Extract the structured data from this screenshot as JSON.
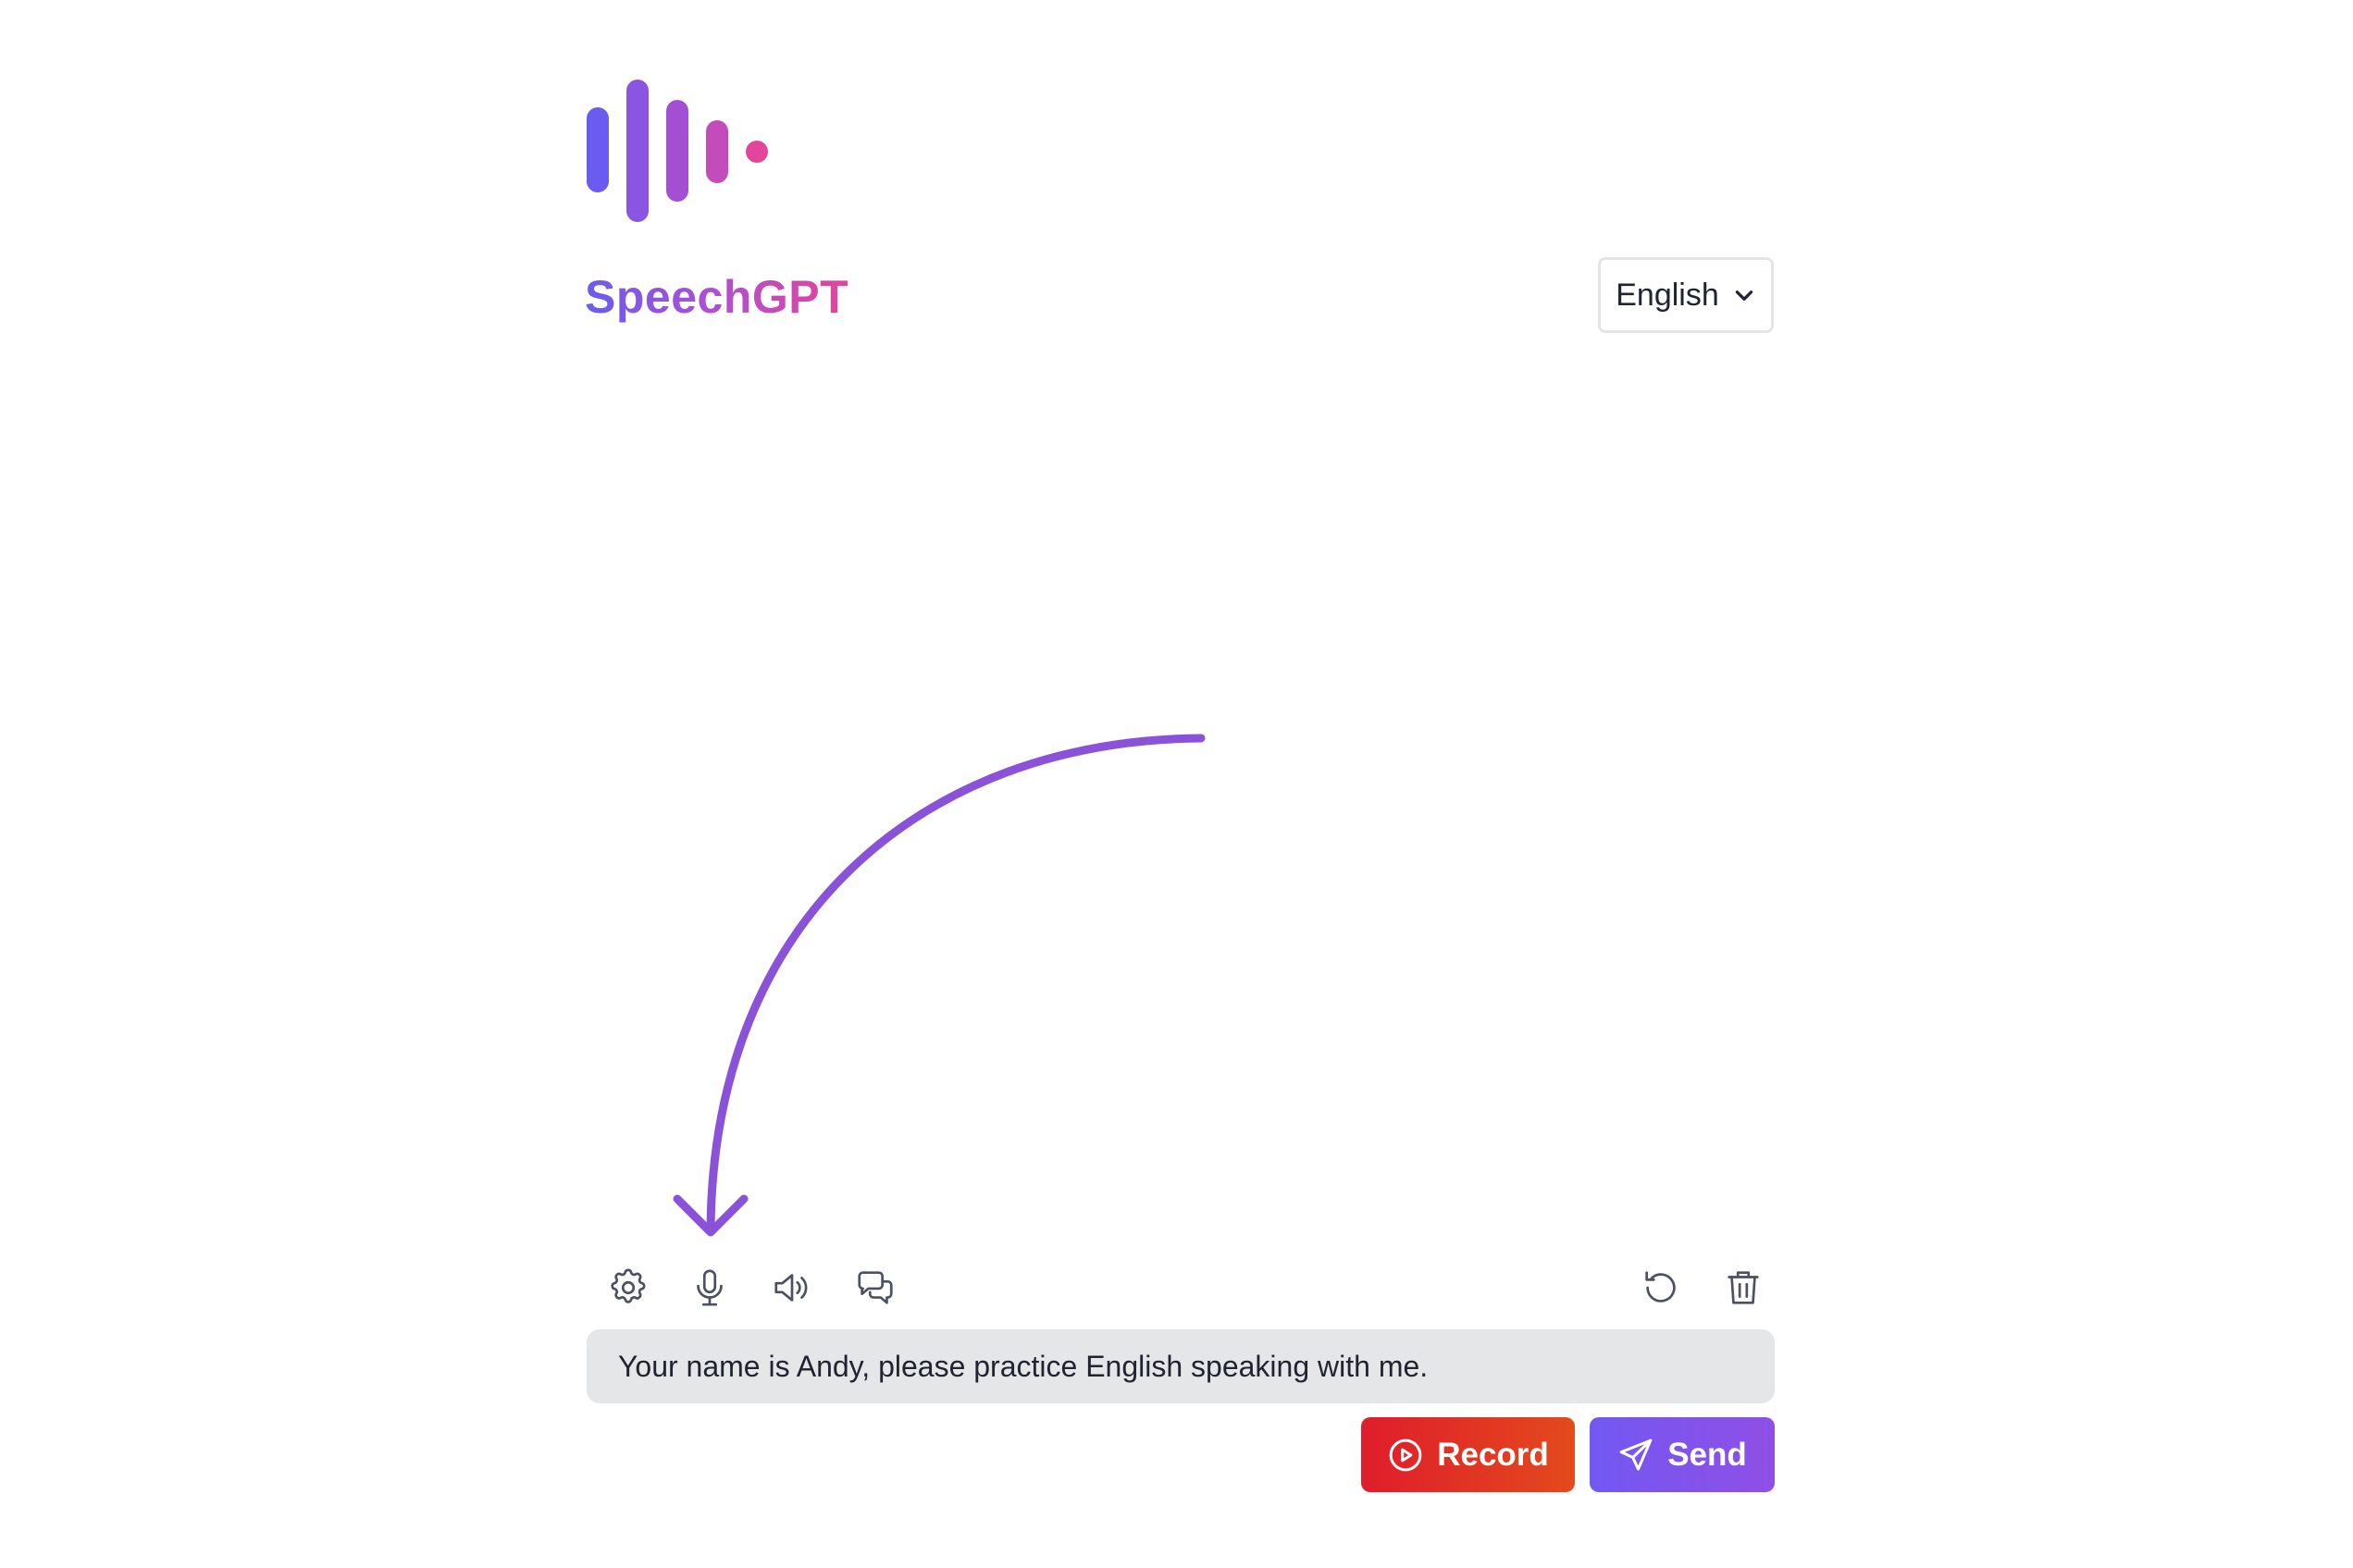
{
  "app": {
    "brand_name": "SpeechGPT",
    "logo_icon": "soundwave-logo",
    "brand_gradient": [
      "#6a5cf0",
      "#e2459a"
    ]
  },
  "language_select": {
    "selected": "English",
    "icon": "chevron-down-icon"
  },
  "toolbar": {
    "left_icons": [
      "gear-icon",
      "microphone-icon",
      "speaker-icon",
      "chat-bubbles-icon"
    ],
    "right_icons": [
      "refresh-icon",
      "trash-icon"
    ]
  },
  "prompt": {
    "value": "Your name is Andy, please practice English speaking with me."
  },
  "actions": {
    "record_label": "Record",
    "send_label": "Send",
    "record_icon": "play-circle-icon",
    "send_icon": "paper-plane-icon",
    "record_color": "#df1d2c",
    "send_color": "#7258f2"
  },
  "annotation": {
    "arrow_color": "#8a52d9",
    "points_to": "microphone-icon"
  }
}
